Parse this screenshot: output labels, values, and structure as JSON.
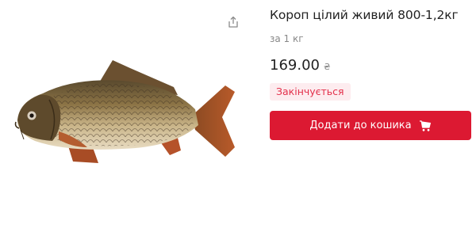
{
  "product": {
    "title": "Короп цілий живий 800-1,2кг",
    "unit_text": "за 1 кг",
    "price": "169.00",
    "currency": "₴",
    "stock_badge": "Закінчується",
    "image_icon": "carp-fish-image"
  },
  "actions": {
    "share_icon": "share-icon",
    "add_to_cart_label": "Додати до кошика",
    "cart_icon": "cart-icon"
  },
  "colors": {
    "accent": "#dc1932",
    "badge_bg": "#fdecef",
    "badge_text": "#e3304b"
  }
}
